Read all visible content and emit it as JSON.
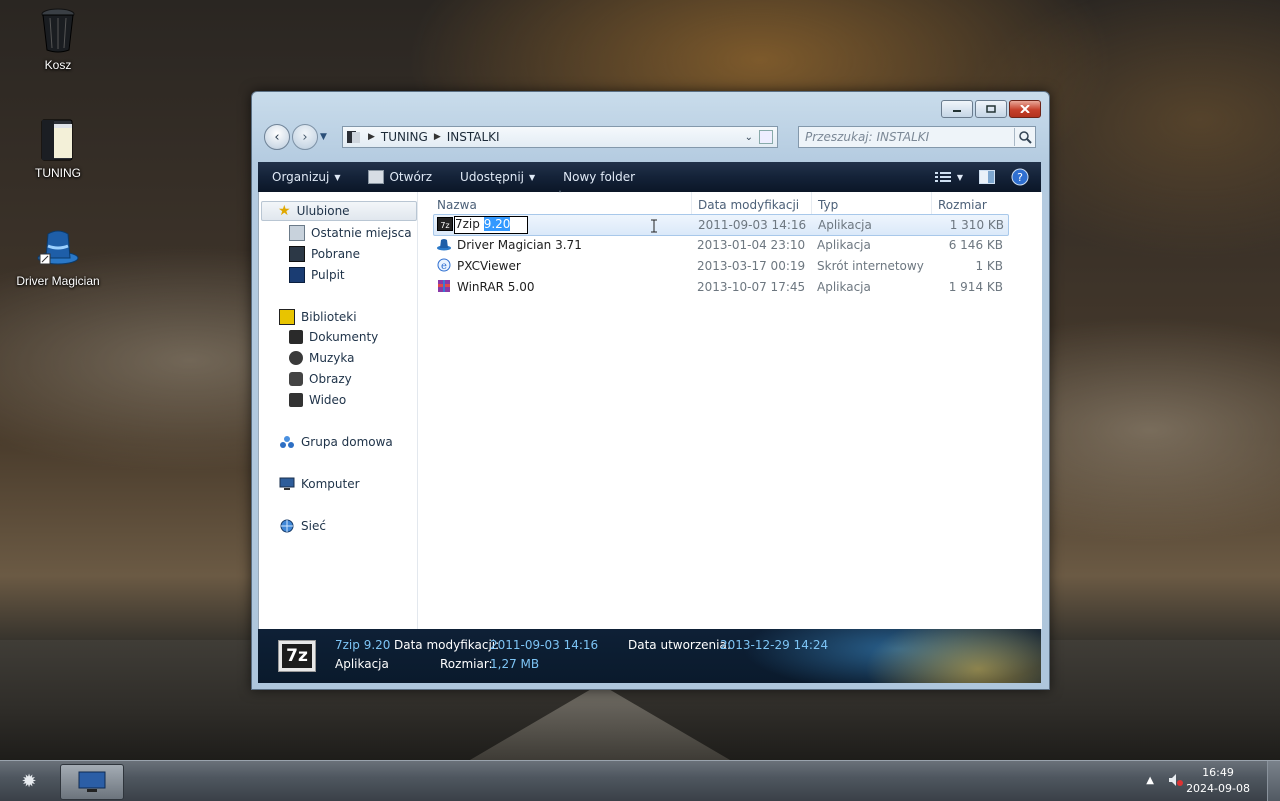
{
  "desktop": {
    "icons": [
      {
        "label": "Kosz"
      },
      {
        "label": "TUNING"
      },
      {
        "label": "Driver Magician"
      }
    ]
  },
  "address": {
    "segments": [
      "TUNING",
      "INSTALKI"
    ]
  },
  "search": {
    "placeholder": "Przeszukaj: INSTALKI"
  },
  "toolbar": {
    "organize": "Organizuj",
    "open": "Otwórz",
    "share": "Udostępnij",
    "new_folder": "Nowy folder"
  },
  "nav": {
    "favorites": "Ulubione",
    "recent": "Ostatnie miejsca",
    "downloads": "Pobrane",
    "desktop": "Pulpit",
    "libraries": "Biblioteki",
    "documents": "Dokumenty",
    "music": "Muzyka",
    "pictures": "Obrazy",
    "video": "Wideo",
    "homegroup": "Grupa domowa",
    "computer": "Komputer",
    "network": "Sieć"
  },
  "columns": {
    "name": "Nazwa",
    "modified": "Data modyfikacji",
    "type": "Typ",
    "size": "Rozmiar"
  },
  "files": [
    {
      "name": "7zip 9.20",
      "name_base": "7zip ",
      "name_selected": "9.20",
      "modified": "2011-09-03 14:16",
      "type": "Aplikacja",
      "size": "1 310 KB"
    },
    {
      "name": "Driver Magician 3.71",
      "modified": "2013-01-04 23:10",
      "type": "Aplikacja",
      "size": "6 146 KB"
    },
    {
      "name": "PXCViewer",
      "modified": "2013-03-17 00:19",
      "type": "Skrót internetowy",
      "size": "1 KB"
    },
    {
      "name": "WinRAR 5.00",
      "modified": "2013-10-07 17:45",
      "type": "Aplikacja",
      "size": "1 914 KB"
    }
  ],
  "details": {
    "icon_text": "7z",
    "name": "7zip 9.20",
    "kind": "Aplikacja",
    "modified_label": "Data modyfikacji:",
    "modified_value": "2011-09-03 14:16",
    "created_label": "Data utworzenia:",
    "created_value": "2013-12-29 14:24",
    "size_label": "Rozmiar:",
    "size_value": "1,27 MB"
  },
  "taskbar": {
    "time": "16:49",
    "date": "2024-09-08"
  },
  "colors": {
    "toolbar_bg": "#142238",
    "details_value": "#7dc4f5",
    "selection": "#3399ff"
  }
}
